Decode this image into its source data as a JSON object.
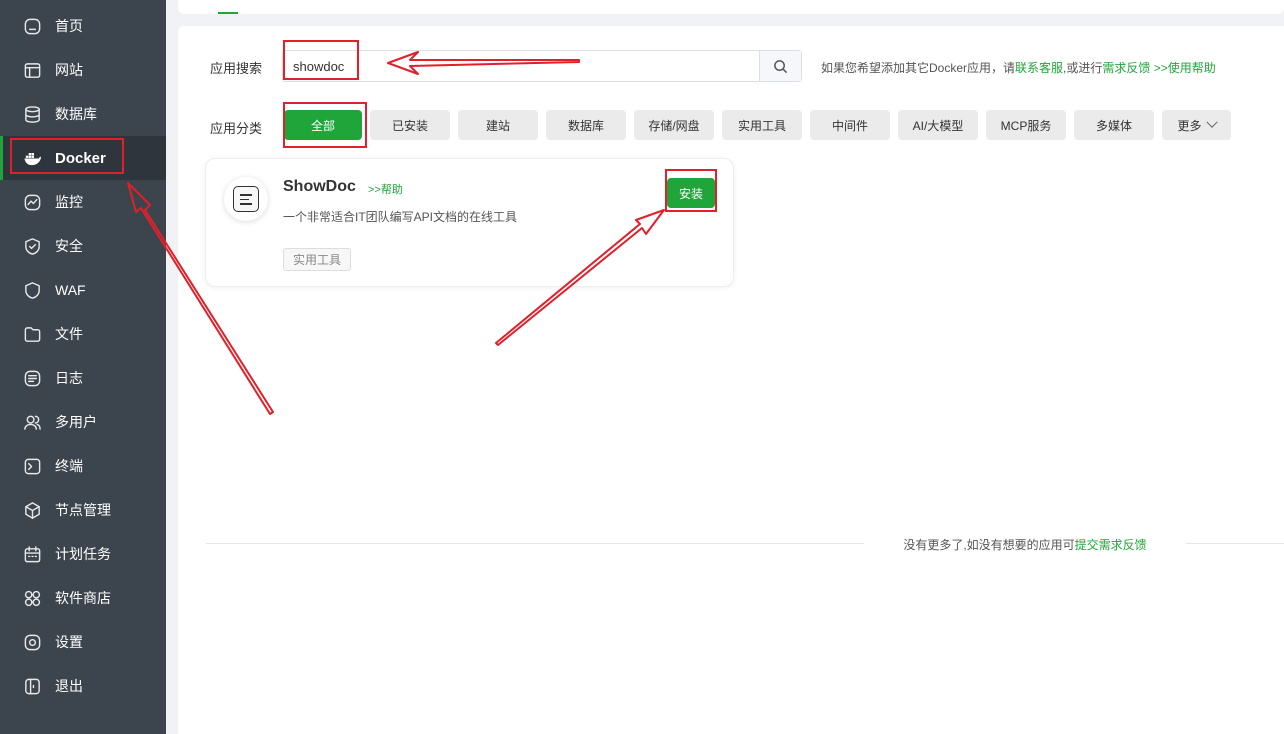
{
  "sidebar": {
    "items": [
      {
        "label": "首页",
        "icon": "home-icon"
      },
      {
        "label": "网站",
        "icon": "website-icon"
      },
      {
        "label": "数据库",
        "icon": "database-icon"
      },
      {
        "label": "Docker",
        "icon": "docker-icon",
        "active": true
      },
      {
        "label": "监控",
        "icon": "monitor-icon"
      },
      {
        "label": "安全",
        "icon": "shield-icon"
      },
      {
        "label": "WAF",
        "icon": "waf-icon"
      },
      {
        "label": "文件",
        "icon": "folder-icon"
      },
      {
        "label": "日志",
        "icon": "log-icon"
      },
      {
        "label": "多用户",
        "icon": "users-icon"
      },
      {
        "label": "终端",
        "icon": "terminal-icon"
      },
      {
        "label": "节点管理",
        "icon": "nodes-icon"
      },
      {
        "label": "计划任务",
        "icon": "calendar-icon"
      },
      {
        "label": "软件商店",
        "icon": "store-icon"
      },
      {
        "label": "设置",
        "icon": "settings-icon"
      },
      {
        "label": "退出",
        "icon": "logout-icon"
      }
    ]
  },
  "search": {
    "label": "应用搜索",
    "value": "showdoc",
    "placeholder": ""
  },
  "hint": {
    "prefix": "如果您希望添加其它Docker应用，请",
    "contact_link": "联系客服",
    "middle": "或进行",
    "feedback_link": "需求反馈",
    "help_link": " >>使用帮助"
  },
  "categories": {
    "label": "应用分类",
    "items": [
      "全部",
      "已安装",
      "建站",
      "数据库",
      "存储/网盘",
      "实用工具",
      "中间件",
      "AI/大模型",
      "MCP服务",
      "多媒体"
    ],
    "more": "更多",
    "selected": "全部"
  },
  "app": {
    "name": "ShowDoc",
    "help": ">>帮助",
    "description": "一个非常适合IT团队编写API文档的在线工具",
    "tag": "实用工具",
    "install_label": "安装"
  },
  "footer": {
    "text": "没有更多了,如没有想要的应用可",
    "link": "提交需求反馈"
  },
  "colors": {
    "accent": "#20a53a",
    "sidebar_bg": "#3c444d",
    "annotation": "#e0202a"
  }
}
